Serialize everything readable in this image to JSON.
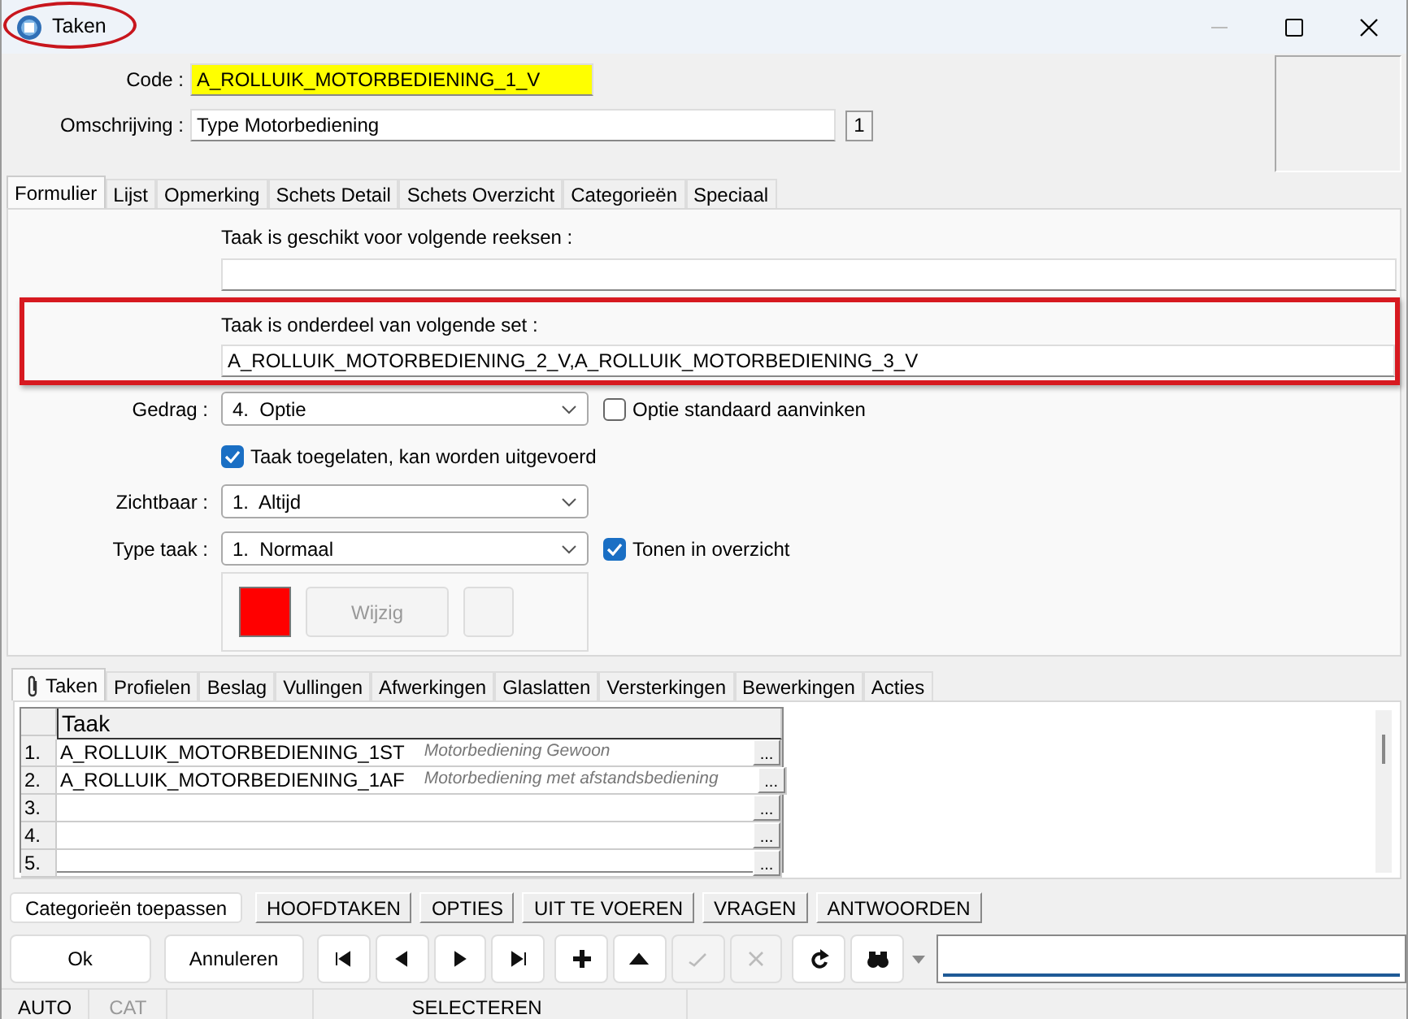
{
  "window": {
    "title": "Taken",
    "title_highlighted": true
  },
  "code": {
    "label": "Code :",
    "value": "A_ROLLUIK_MOTORBEDIENING_1_V"
  },
  "omschrijving": {
    "label": "Omschrijving :",
    "value": "Type Motorbediening",
    "counter": "1"
  },
  "tabs": [
    {
      "label": "Formulier",
      "selected": true
    },
    {
      "label": "Lijst",
      "selected": false
    },
    {
      "label": "Opmerking",
      "selected": false
    },
    {
      "label": "Schets Detail",
      "selected": false
    },
    {
      "label": "Schets Overzicht",
      "selected": false
    },
    {
      "label": "Categorieën",
      "selected": false
    },
    {
      "label": "Speciaal",
      "selected": false
    }
  ],
  "reeksen": {
    "label": "Taak is geschikt voor volgende reeksen :"
  },
  "set": {
    "label": "Taak is onderdeel van volgende set :",
    "value": "A_ROLLUIK_MOTORBEDIENING_2_V,A_ROLLUIK_MOTORBEDIENING_3_V",
    "highlighted": true
  },
  "gedrag": {
    "label": "Gedrag :",
    "value": "4.  Optie"
  },
  "optie_standaard": {
    "label": "Optie standaard aanvinken",
    "checked": false
  },
  "toegelaten": {
    "label": "Taak toegelaten, kan worden uitgevoerd",
    "checked": true
  },
  "zichtbaar": {
    "label": "Zichtbaar :",
    "value": "1.  Altijd"
  },
  "type_taak": {
    "label": "Type taak :",
    "value": "1.  Normaal"
  },
  "tonen": {
    "label": "Tonen in overzicht",
    "checked": true
  },
  "kleur": {
    "color": "#ff0000",
    "button": "Wijzig"
  },
  "sub_tabs": [
    {
      "label": "Taken",
      "selected": true
    },
    {
      "label": "Profielen",
      "selected": false
    },
    {
      "label": "Beslag",
      "selected": false
    },
    {
      "label": "Vullingen",
      "selected": false
    },
    {
      "label": "Afwerkingen",
      "selected": false
    },
    {
      "label": "Glaslatten",
      "selected": false
    },
    {
      "label": "Versterkingen",
      "selected": false
    },
    {
      "label": "Bewerkingen",
      "selected": false
    },
    {
      "label": "Acties",
      "selected": false
    }
  ],
  "grid": {
    "column": "Taak",
    "rows": [
      {
        "number": "1.",
        "code": "A_ROLLUIK_MOTORBEDIENING_1ST",
        "description": "Motorbediening Gewoon",
        "button": "..."
      },
      {
        "number": "2.",
        "code": "A_ROLLUIK_MOTORBEDIENING_1AF",
        "description": "Motorbediening met afstandsbediening",
        "button": "..."
      },
      {
        "number": "3.",
        "button": "..."
      },
      {
        "number": "4.",
        "button": "..."
      },
      {
        "number": "5.",
        "button": "..."
      }
    ]
  },
  "action_buttons": [
    "Categorieën toepassen",
    "HOOFDTAKEN",
    "OPTIES",
    "UIT TE VOEREN",
    "VRAGEN",
    "ANTWOORDEN"
  ],
  "dialog_buttons": [
    "Ok",
    "Annuleren"
  ],
  "nav_buttons": [
    {
      "disabled": false
    },
    {
      "disabled": false
    },
    {
      "disabled": false
    },
    {
      "disabled": false
    },
    {
      "disabled": false
    },
    {
      "disabled": false
    },
    {
      "disabled": true
    },
    {
      "disabled": true
    },
    {
      "disabled": false
    },
    {
      "disabled": false
    }
  ],
  "status_bar": [
    {
      "text": "AUTO",
      "disabled": false
    },
    {
      "text": "CAT",
      "disabled": true
    },
    {
      "text": "SELECTEREN",
      "disabled": false
    }
  ]
}
